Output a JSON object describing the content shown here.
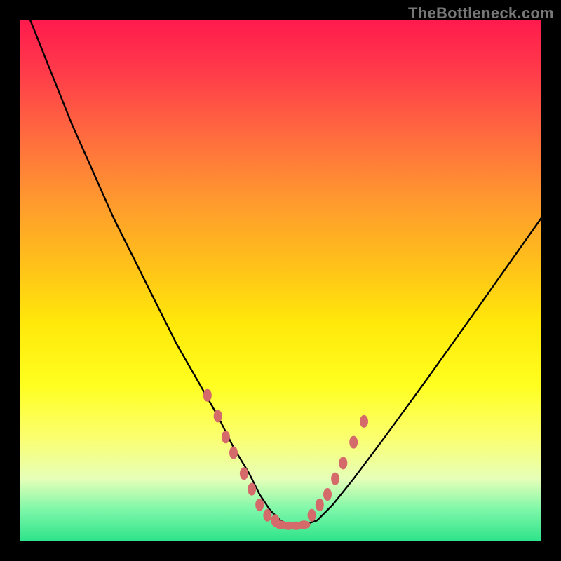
{
  "watermark": "TheBottleneck.com",
  "chart_data": {
    "type": "line",
    "title": "",
    "xlabel": "",
    "ylabel": "",
    "xlim": [
      0,
      100
    ],
    "ylim": [
      0,
      100
    ],
    "series": [
      {
        "name": "bottleneck-curve",
        "x": [
          2,
          6,
          10,
          14,
          18,
          22,
          26,
          30,
          34,
          38,
          41,
          44,
          46,
          48,
          50,
          52,
          54,
          57,
          60,
          64,
          70,
          78,
          88,
          100
        ],
        "y": [
          100,
          90,
          80,
          71,
          62,
          54,
          46,
          38,
          31,
          24,
          18,
          13,
          9,
          6,
          4,
          3,
          3,
          4,
          7,
          12,
          20,
          31,
          45,
          62
        ]
      }
    ],
    "markers_left": {
      "name": "scatter-left",
      "points": [
        {
          "x": 36,
          "y": 28
        },
        {
          "x": 38,
          "y": 24
        },
        {
          "x": 39.5,
          "y": 20
        },
        {
          "x": 41,
          "y": 17
        },
        {
          "x": 43,
          "y": 13
        },
        {
          "x": 44.5,
          "y": 10
        },
        {
          "x": 46,
          "y": 7
        },
        {
          "x": 47.5,
          "y": 5
        },
        {
          "x": 49,
          "y": 4
        }
      ]
    },
    "markers_bottom": {
      "name": "scatter-bottom",
      "points": [
        {
          "x": 50,
          "y": 3.2
        },
        {
          "x": 51.5,
          "y": 3
        },
        {
          "x": 53,
          "y": 3
        },
        {
          "x": 54.5,
          "y": 3.2
        }
      ]
    },
    "markers_right": {
      "name": "scatter-right",
      "points": [
        {
          "x": 56,
          "y": 5
        },
        {
          "x": 57.5,
          "y": 7
        },
        {
          "x": 59,
          "y": 9
        },
        {
          "x": 60.5,
          "y": 12
        },
        {
          "x": 62,
          "y": 15
        },
        {
          "x": 64,
          "y": 19
        },
        {
          "x": 66,
          "y": 23
        }
      ]
    },
    "colors": {
      "curve": "#000000",
      "marker": "#d46a6a"
    }
  }
}
